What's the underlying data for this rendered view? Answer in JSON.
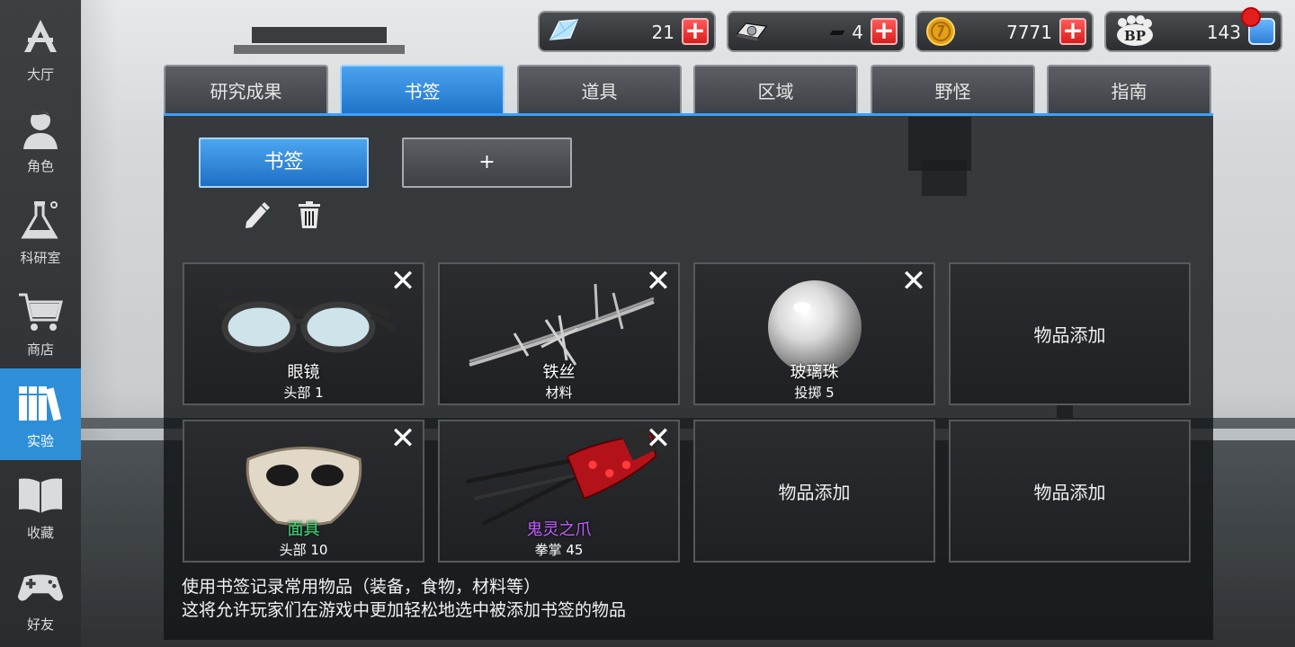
{
  "sidebar": {
    "items": [
      {
        "label": "大厅",
        "icon": "lobby-icon"
      },
      {
        "label": "角色",
        "icon": "character-icon"
      },
      {
        "label": "科研室",
        "icon": "flask-icon"
      },
      {
        "label": "商店",
        "icon": "cart-icon"
      },
      {
        "label": "实验",
        "icon": "books-icon",
        "active": true
      },
      {
        "label": "收藏",
        "icon": "open-book-icon"
      },
      {
        "label": "好友",
        "icon": "gamepad-icon"
      }
    ]
  },
  "currency": {
    "crystal": {
      "value": "21",
      "icon": "crystal-icon"
    },
    "drive": {
      "value": "4",
      "icon": "hard-drive-icon"
    },
    "coin": {
      "value": "7771",
      "icon": "gold-coin-icon"
    },
    "bp": {
      "value": "143",
      "icon": "bp-paw-icon",
      "badge": "BP"
    }
  },
  "tabs": [
    {
      "label": "研究成果"
    },
    {
      "label": "书签",
      "active": true
    },
    {
      "label": "道具"
    },
    {
      "label": "区域"
    },
    {
      "label": "野怪"
    },
    {
      "label": "指南"
    }
  ],
  "subtabs": {
    "bookmark_label": "书签",
    "add_label": "+"
  },
  "items": [
    {
      "name": "眼镜",
      "sub": "头部 1",
      "name_color": "#ffffff",
      "icon": "glasses-icon"
    },
    {
      "name": "铁丝",
      "sub": "材料",
      "name_color": "#ffffff",
      "icon": "barbed-wire-icon"
    },
    {
      "name": "玻璃珠",
      "sub": "投掷 5",
      "name_color": "#ffffff",
      "icon": "glass-bead-icon"
    },
    {
      "empty_label": "物品添加"
    },
    {
      "name": "面具",
      "sub": "头部 10",
      "name_color": "#3fe07a",
      "icon": "mask-icon"
    },
    {
      "name": "鬼灵之爪",
      "sub": "拳掌 45",
      "name_color": "#c25cff",
      "icon": "claw-icon"
    },
    {
      "empty_label": "物品添加"
    },
    {
      "empty_label": "物品添加"
    }
  ],
  "description": {
    "line1": "使用书签记录常用物品（装备，食物，材料等）",
    "line2": "这将允许玩家们在游戏中更加轻松地选中被添加书签的物品"
  },
  "colors": {
    "accent": "#2e8fd8",
    "plus_red": "#d81e1e"
  }
}
